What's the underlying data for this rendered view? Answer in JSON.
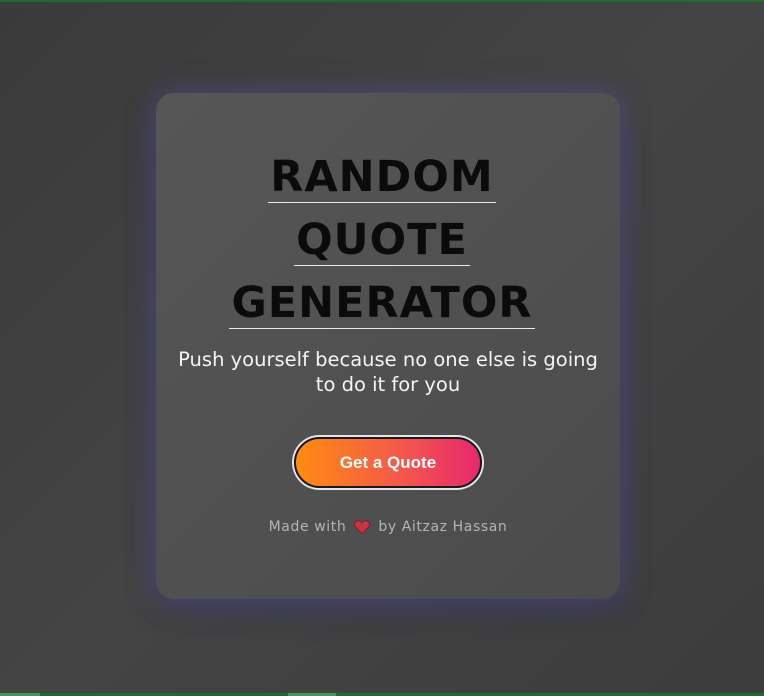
{
  "app": {
    "title_lines": [
      "RANDOM",
      "QUOTE",
      "GENERATOR"
    ]
  },
  "quote": {
    "text": "Push yourself because no one else is going to do it for you"
  },
  "actions": {
    "get_quote_label": "Get a Quote"
  },
  "footer": {
    "made_with": "Made with",
    "heart_icon": "heart-icon",
    "by_author": "by Aitzaz Hassan"
  },
  "colors": {
    "background": "#404040",
    "card": "#515151",
    "title_text": "#0b0b0b",
    "button_gradient_start": "#ff8c10",
    "button_gradient_end": "#e8286e",
    "heart": "#c93443"
  }
}
